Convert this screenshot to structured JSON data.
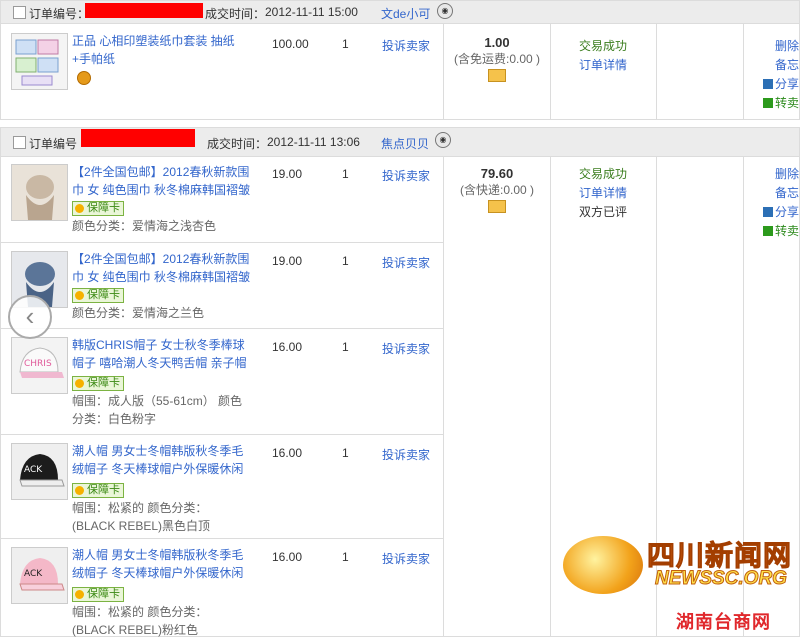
{
  "colors": {
    "link": "#3366cc",
    "success": "#3a7d1d",
    "header_bg": "#ececec",
    "redaction": "#ff0000"
  },
  "orders": [
    {
      "header": {
        "order_no_label": "订单编号：",
        "time_label": "成交时间：",
        "time": "2012-11-11 15:00",
        "seller": "文de小可"
      },
      "items": [
        {
          "title": "正品 心相印塑装纸巾套装 抽纸+手帕纸",
          "price": "100.00",
          "qty": "1",
          "complain": "投诉卖家"
        }
      ],
      "total": {
        "amount": "1.00",
        "note": "(含免运费:0.00 )"
      },
      "status": {
        "result": "交易成功",
        "detail": "订单详情",
        "extra": ""
      },
      "ops": {
        "delete": "删除",
        "remark": "备忘",
        "share": "分享",
        "resell": "转卖"
      }
    },
    {
      "header": {
        "order_no_label": "订单编号",
        "time_label": "成交时间：",
        "time": "2012-11-11 13:06",
        "seller": "焦点贝贝"
      },
      "items": [
        {
          "title": "【2件全国包邮】2012春秋新款围巾 女 纯色围巾 秋冬棉麻韩国褶皱",
          "price": "19.00",
          "qty": "1",
          "complain": "投诉卖家",
          "badge": "保障卡",
          "attr": "颜色分类：爱情海之浅杏色"
        },
        {
          "title": "【2件全国包邮】2012春秋新款围巾 女 纯色围巾 秋冬棉麻韩国褶皱",
          "price": "19.00",
          "qty": "1",
          "complain": "投诉卖家",
          "badge": "保障卡",
          "attr": "颜色分类：爱情海之兰色"
        },
        {
          "title": "韩版CHRIS帽子 女士秋冬季棒球帽子 嘻哈潮人冬天鸭舌帽 亲子帽",
          "price": "16.00",
          "qty": "1",
          "complain": "投诉卖家",
          "badge": "保障卡",
          "attr": "帽围：成人版（55-61cm） 颜色分类：白色粉字"
        },
        {
          "title": "潮人帽 男女士冬帽韩版秋冬季毛绒帽子 冬天棒球帽户外保暖休闲",
          "price": "16.00",
          "qty": "1",
          "complain": "投诉卖家",
          "badge": "保障卡",
          "attr": "帽围：松紧的 颜色分类：(BLACK REBEL)黑色白顶"
        },
        {
          "title": "潮人帽 男女士冬帽韩版秋冬季毛绒帽子 冬天棒球帽户外保暖休闲",
          "price": "16.00",
          "qty": "1",
          "complain": "投诉卖家",
          "badge": "保障卡",
          "attr": "帽围：松紧的 颜色分类：(BLACK REBEL)粉红色"
        }
      ],
      "total": {
        "amount": "79.60",
        "note": "(含快递:0.00 )"
      },
      "status": {
        "result": "交易成功",
        "detail": "订单详情",
        "extra": "双方已评"
      },
      "ops": {
        "delete": "删除",
        "remark": "备忘",
        "share": "分享",
        "resell": "转卖"
      }
    }
  ],
  "watermark": {
    "cn": "四川新闻网",
    "en": "NEWSSC.ORG",
    "secondary": "湖南台商网"
  }
}
